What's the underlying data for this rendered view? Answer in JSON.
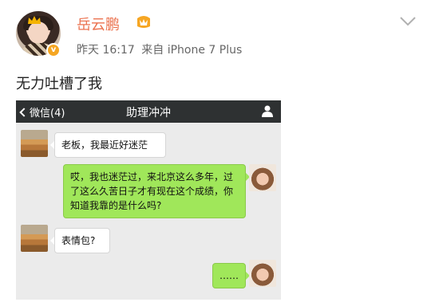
{
  "post": {
    "username": "岳云鹏",
    "time": "昨天 16:17",
    "source": "来自 iPhone 7 Plus",
    "text": "无力吐槽了我",
    "vip_badge": "v"
  },
  "wechat": {
    "back_label": "微信(4)",
    "chat_title": "助理冲冲",
    "messages": [
      {
        "side": "left",
        "avatar": "desert-avatar",
        "text": "老板，我最近好迷茫"
      },
      {
        "side": "right",
        "avatar": "girl-avatar",
        "text": "哎，我也迷茫过，来北京这么多年，过了这么久苦日子才有现在这个成绩，你知道我靠的是什么吗?"
      },
      {
        "side": "left",
        "avatar": "desert-avatar",
        "text": "表情包?"
      },
      {
        "side": "right",
        "avatar": "girl-avatar",
        "text": "……"
      }
    ]
  },
  "colors": {
    "username": "#eb7350",
    "wechat_bar": "#2e3132",
    "bubble_right": "#a0e75a"
  },
  "icons": [
    "crown-icon",
    "level-badge-icon",
    "chevron-down-icon",
    "back-arrow-icon",
    "person-icon"
  ]
}
